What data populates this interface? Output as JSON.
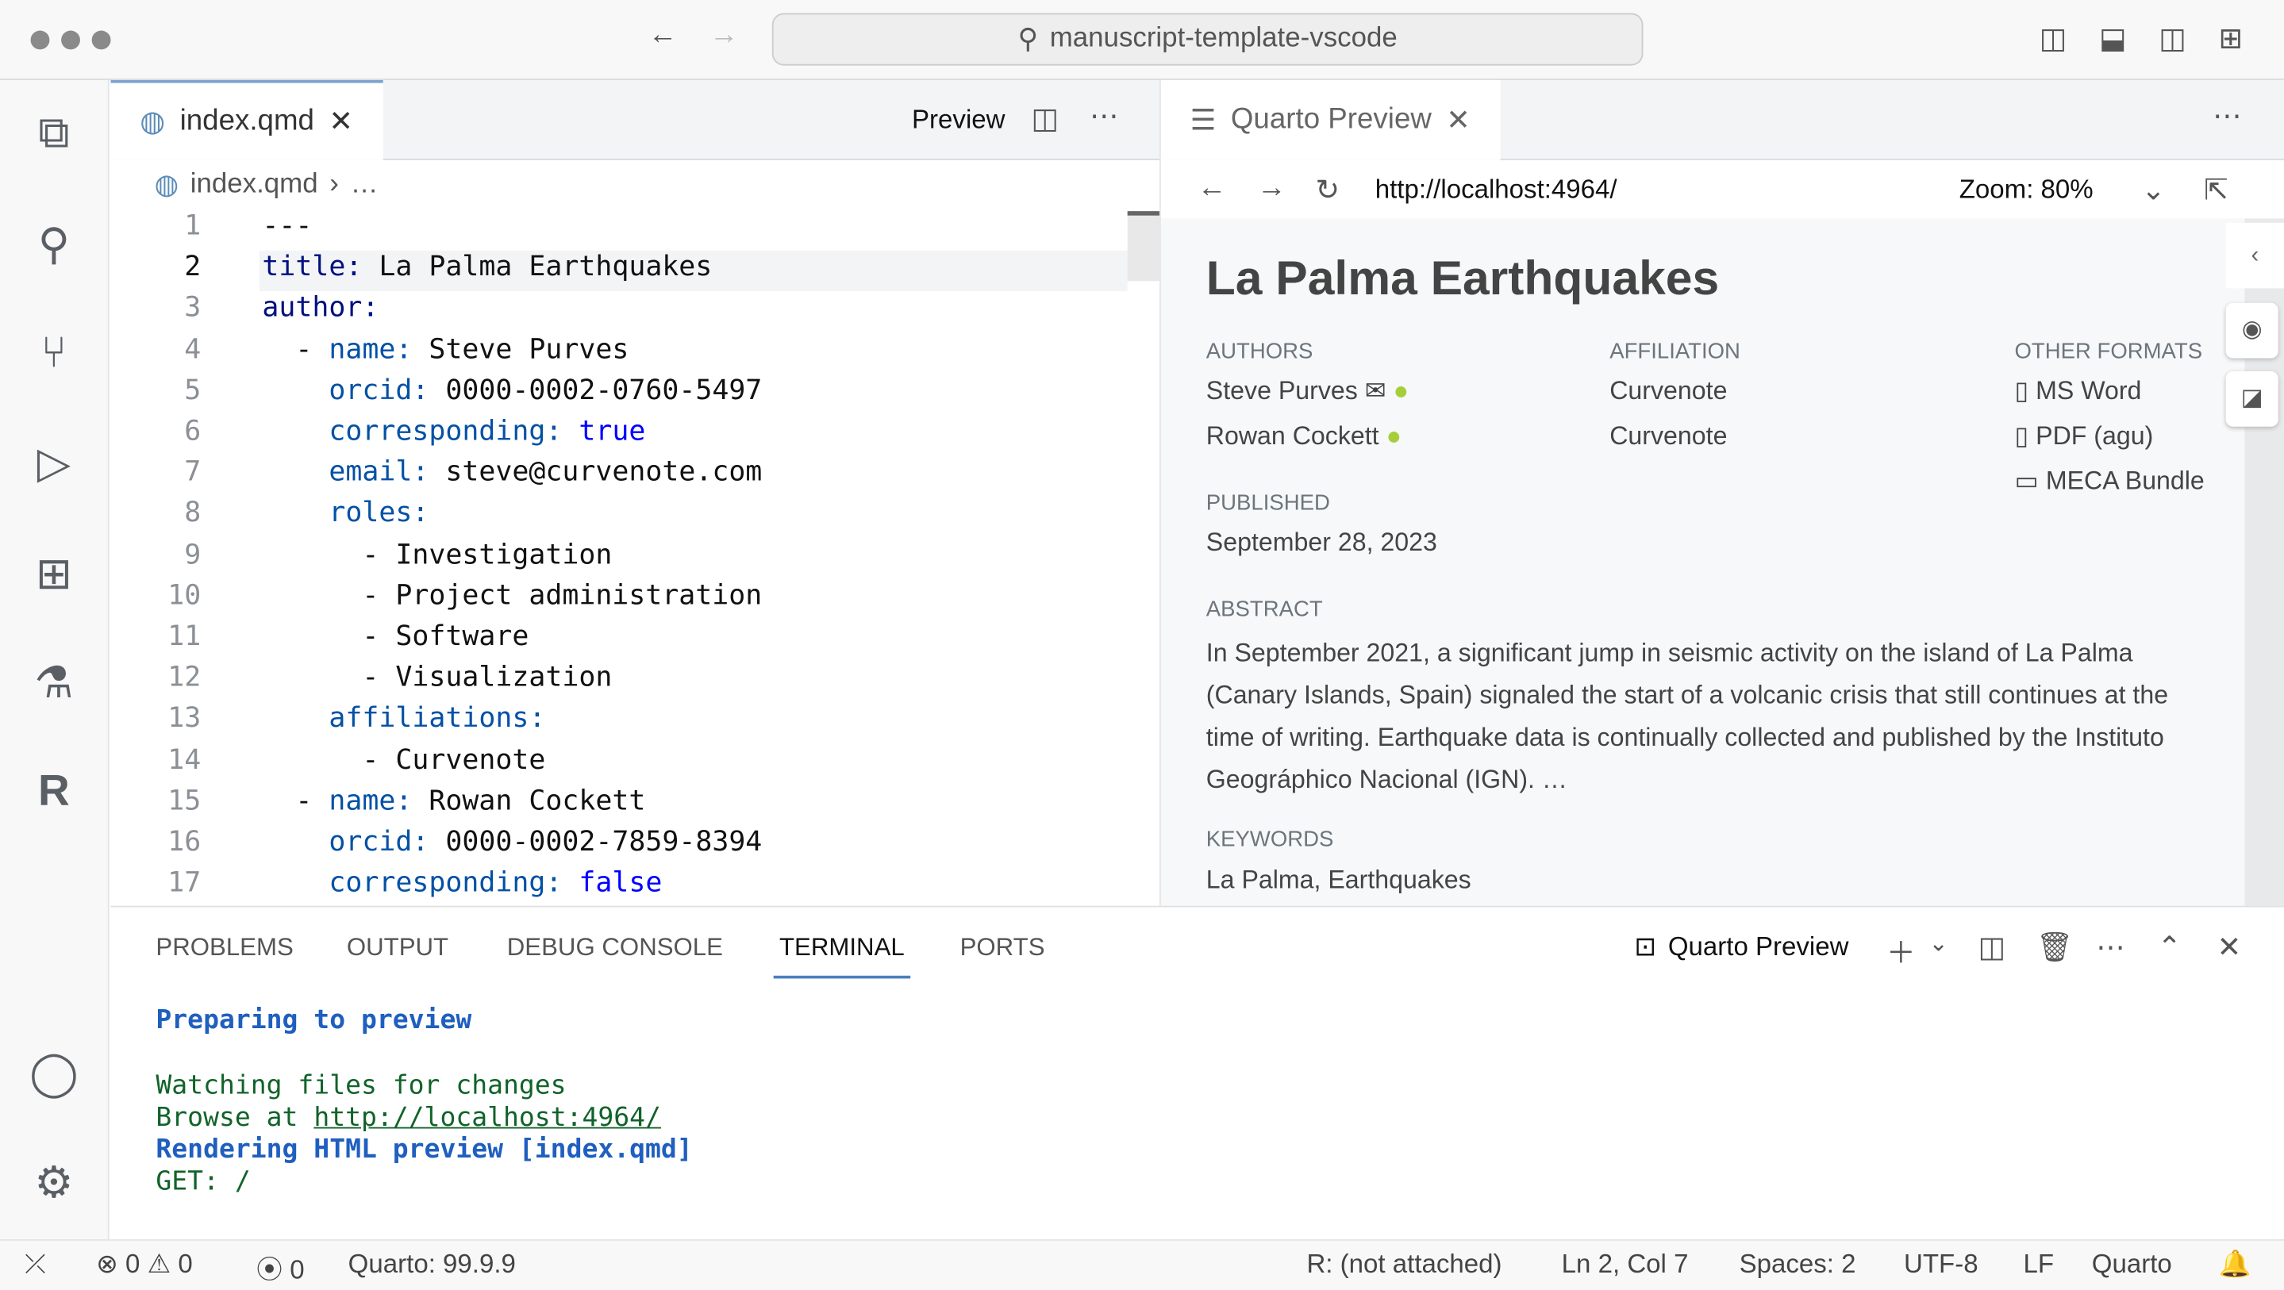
{
  "titlebar": {
    "search": "manuscript-template-vscode"
  },
  "editor": {
    "tab": "index.qmd",
    "preview_label": "Preview",
    "breadcrumb": [
      "index.qmd",
      "…"
    ],
    "lines": [
      {
        "n": "1",
        "parts": [
          [
            "t",
            "---"
          ]
        ]
      },
      {
        "n": "2",
        "parts": [
          [
            "k0",
            "title:"
          ],
          [
            "t",
            " La Palma Earthquakes"
          ]
        ]
      },
      {
        "n": "3",
        "parts": [
          [
            "k0",
            "author:"
          ]
        ]
      },
      {
        "n": "4",
        "parts": [
          [
            "t",
            "  - "
          ],
          [
            "k1",
            "name:"
          ],
          [
            "t",
            " Steve Purves"
          ]
        ]
      },
      {
        "n": "5",
        "parts": [
          [
            "t",
            "    "
          ],
          [
            "k1",
            "orcid:"
          ],
          [
            "t",
            " 0000-0002-0760-5497"
          ]
        ]
      },
      {
        "n": "6",
        "parts": [
          [
            "t",
            "    "
          ],
          [
            "k1",
            "corresponding:"
          ],
          [
            "b",
            " true"
          ]
        ]
      },
      {
        "n": "7",
        "parts": [
          [
            "t",
            "    "
          ],
          [
            "k1",
            "email:"
          ],
          [
            "t",
            " steve@curvenote.com"
          ]
        ]
      },
      {
        "n": "8",
        "parts": [
          [
            "t",
            "    "
          ],
          [
            "k1",
            "roles:"
          ]
        ]
      },
      {
        "n": "9",
        "parts": [
          [
            "t",
            "      - Investigation"
          ]
        ]
      },
      {
        "n": "10",
        "parts": [
          [
            "t",
            "      - Project administration"
          ]
        ]
      },
      {
        "n": "11",
        "parts": [
          [
            "t",
            "      - Software"
          ]
        ]
      },
      {
        "n": "12",
        "parts": [
          [
            "t",
            "      - Visualization"
          ]
        ]
      },
      {
        "n": "13",
        "parts": [
          [
            "t",
            "    "
          ],
          [
            "k1",
            "affiliations:"
          ]
        ]
      },
      {
        "n": "14",
        "parts": [
          [
            "t",
            "      - Curvenote"
          ]
        ]
      },
      {
        "n": "15",
        "parts": [
          [
            "t",
            "  - "
          ],
          [
            "k1",
            "name:"
          ],
          [
            "t",
            " Rowan Cockett"
          ]
        ]
      },
      {
        "n": "16",
        "parts": [
          [
            "t",
            "    "
          ],
          [
            "k1",
            "orcid:"
          ],
          [
            "t",
            " 0000-0002-7859-8394"
          ]
        ]
      },
      {
        "n": "17",
        "parts": [
          [
            "t",
            "    "
          ],
          [
            "k1",
            "corresponding:"
          ],
          [
            "b",
            " false"
          ]
        ]
      }
    ]
  },
  "preview": {
    "tab": "Quarto Preview",
    "url": "http://localhost:4964/",
    "zoom": "Zoom: 80%",
    "title": "La Palma Earthquakes",
    "authors_h": "AUTHORS",
    "affiliation_h": "AFFILIATION",
    "formats_h": "OTHER FORMATS",
    "authors": [
      "Steve Purves",
      "Rowan Cockett"
    ],
    "affiliations": [
      "Curvenote",
      "Curvenote"
    ],
    "formats": [
      "MS Word",
      "PDF (agu)",
      "MECA Bundle"
    ],
    "published_h": "PUBLISHED",
    "published": "September 28, 2023",
    "abstract_h": "ABSTRACT",
    "abstract": "In September 2021, a significant jump in seismic activity on the island of La Palma (Canary Islands, Spain) signaled the start of a volcanic crisis that still continues at the time of writing. Earthquake data is continually collected and published by the Instituto Geográphico Nacional (IGN). …",
    "keywords_h": "KEYWORDS",
    "keywords": "La Palma, Earthquakes"
  },
  "panel": {
    "tabs": [
      "PROBLEMS",
      "OUTPUT",
      "DEBUG CONSOLE",
      "TERMINAL",
      "PORTS"
    ],
    "terminal_name": "Quarto Preview",
    "lines": [
      "Preparing to preview",
      "Watching files for changes",
      "Browse at ",
      "http://localhost:4964/",
      "Rendering HTML preview [index.qmd]",
      "GET: /"
    ]
  },
  "status": {
    "errors": "0",
    "warnings": "0",
    "ports": "0",
    "quarto": "Quarto: 99.9.9",
    "r": "R: (not attached)",
    "pos": "Ln 2, Col 7",
    "spaces": "Spaces: 2",
    "encoding": "UTF-8",
    "eol": "LF",
    "lang": "Quarto"
  },
  "colors": {
    "accent": "#0451a5",
    "terminal_green": "#116329",
    "orcid": "#a6ce39"
  }
}
